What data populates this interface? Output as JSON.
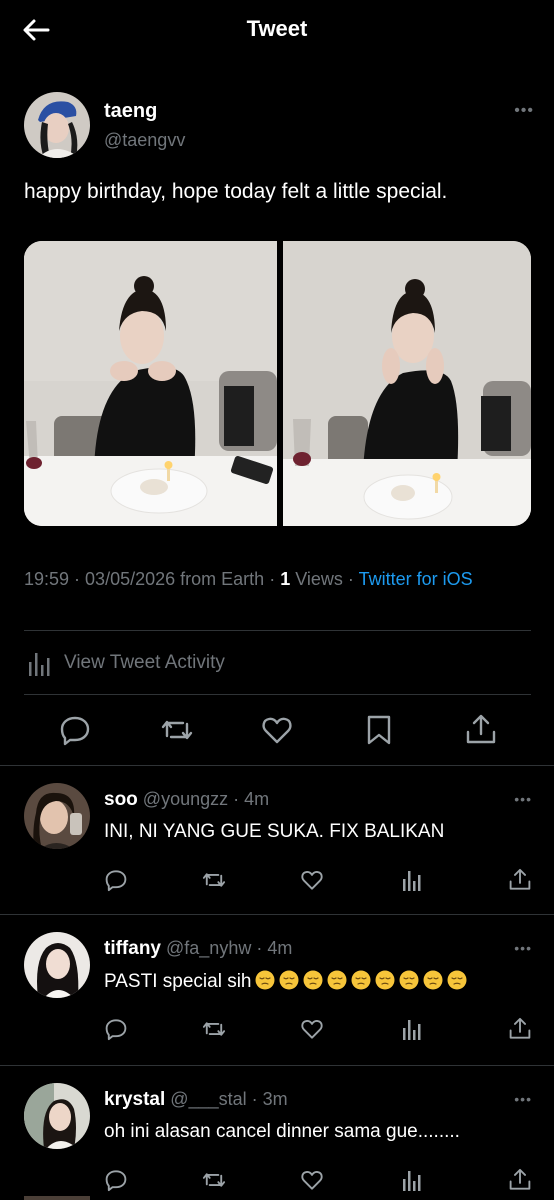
{
  "header": {
    "title": "Tweet",
    "back_icon": "arrow-left-icon"
  },
  "tweet": {
    "author_name": "taeng",
    "author_handle": "@taengvv",
    "text": "happy birthday, hope today felt a little special.",
    "time": "19:59",
    "date": "03/05/2026",
    "location": "from Earth",
    "views_count": "1",
    "views_label": "Views",
    "source": "Twitter for iOS",
    "activity_label": "View Tweet Activity"
  },
  "actions": [
    "reply-icon",
    "retweet-icon",
    "like-icon",
    "bookmark-icon",
    "share-icon"
  ],
  "replies": [
    {
      "name": "soo",
      "handle": "@youngzz",
      "time": "4m",
      "text": "INI, NI YANG GUE SUKA. FIX BALIKAN",
      "emoji_count": 0
    },
    {
      "name": "tiffany",
      "handle": "@fa_nyhw",
      "time": "4m",
      "text": "PASTI special sih",
      "emoji_count": 9
    },
    {
      "name": "krystal",
      "handle": "@___stal",
      "time": "3m",
      "text": "oh ini alasan cancel dinner sama gue........",
      "emoji_count": 0
    }
  ],
  "colors": {
    "background": "#000000",
    "text": "#e7e9ea",
    "muted": "#71767b",
    "link": "#1d9bf0",
    "divider": "#2f3336"
  }
}
